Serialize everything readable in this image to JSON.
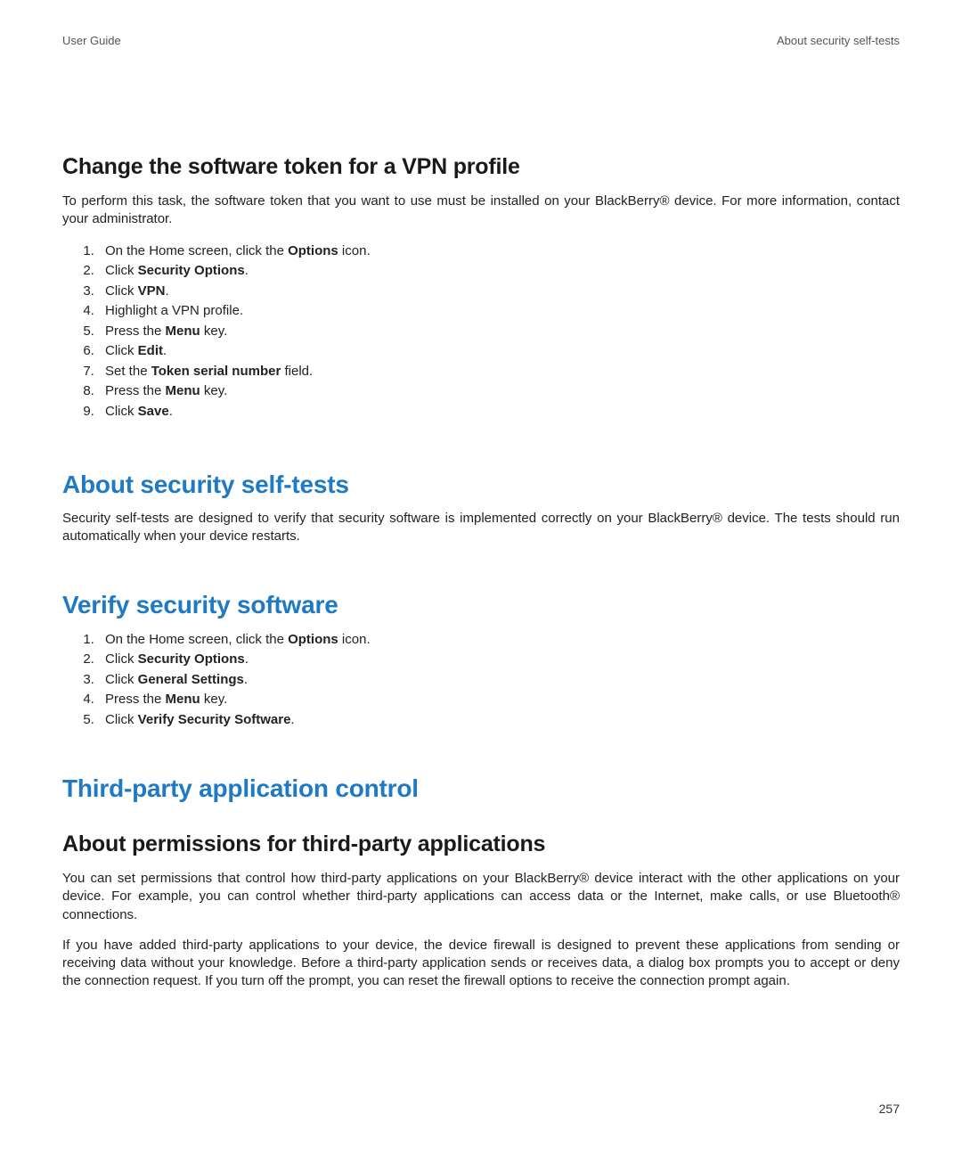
{
  "header": {
    "left": "User Guide",
    "right": "About security self-tests"
  },
  "section1": {
    "heading": "Change the software token for a VPN profile",
    "intro": "To perform this task, the software token that you want to use must be installed on your BlackBerry® device. For more information, contact your administrator.",
    "steps": [
      {
        "pre": "On the Home screen, click the ",
        "bold": "Options",
        "post": " icon."
      },
      {
        "pre": "Click ",
        "bold": "Security Options",
        "post": "."
      },
      {
        "pre": "Click ",
        "bold": "VPN",
        "post": "."
      },
      {
        "pre": "Highlight a VPN profile.",
        "bold": "",
        "post": ""
      },
      {
        "pre": "Press the ",
        "bold": "Menu",
        "post": " key."
      },
      {
        "pre": "Click ",
        "bold": "Edit",
        "post": "."
      },
      {
        "pre": "Set the ",
        "bold": "Token serial number",
        "post": " field."
      },
      {
        "pre": "Press the ",
        "bold": "Menu",
        "post": " key."
      },
      {
        "pre": "Click ",
        "bold": "Save",
        "post": "."
      }
    ]
  },
  "section2": {
    "heading": "About security self-tests",
    "body": "Security self-tests are designed to verify that security software is implemented correctly on your BlackBerry® device. The tests should run automatically when your device restarts."
  },
  "section3": {
    "heading": "Verify security software",
    "steps": [
      {
        "pre": "On the Home screen, click the ",
        "bold": "Options",
        "post": " icon."
      },
      {
        "pre": "Click ",
        "bold": "Security Options",
        "post": "."
      },
      {
        "pre": "Click ",
        "bold": "General Settings",
        "post": "."
      },
      {
        "pre": "Press the ",
        "bold": "Menu",
        "post": " key."
      },
      {
        "pre": "Click ",
        "bold": "Verify Security Software",
        "post": "."
      }
    ]
  },
  "section4": {
    "heading": "Third-party application control",
    "subheading": "About permissions for third-party applications",
    "p1": "You can set permissions that control how third-party applications on your BlackBerry® device interact with the other applications on your device. For example, you can control whether third-party applications can access data or the Internet, make calls, or use Bluetooth® connections.",
    "p2": "If you have added third-party applications to your device, the device firewall is designed to prevent these applications from sending or receiving data without your knowledge. Before a third-party application sends or receives data, a dialog box prompts you to accept or deny the connection request. If you turn off the prompt, you can reset the firewall options to receive the connection prompt again."
  },
  "page_number": "257"
}
